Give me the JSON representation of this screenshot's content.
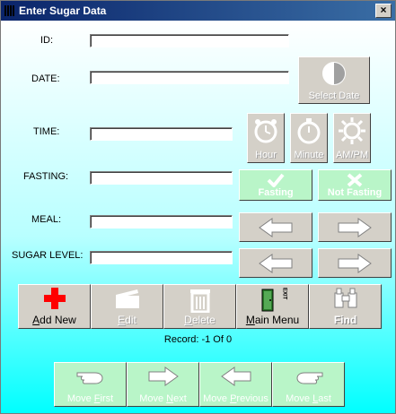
{
  "window": {
    "title": "Enter Sugar Data",
    "close_glyph": "×"
  },
  "labels": {
    "id": "ID:",
    "date": "DATE:",
    "time": "TIME:",
    "fasting": "FASTING:",
    "meal": "MEAL:",
    "sugar_level": "SUGAR LEVEL:"
  },
  "fields": {
    "id": "",
    "date": "",
    "time": "",
    "fasting": "",
    "meal": "",
    "sugar_level": ""
  },
  "buttons": {
    "select_date": "Select Date",
    "hour": "Hour",
    "minute": "Minute",
    "ampm": "AM/PM",
    "fasting": "Fasting",
    "not_fasting": "Not Fasting"
  },
  "actions": {
    "add_new_pre": "A",
    "add_new_post": "dd New",
    "edit_pre": "E",
    "edit_post": "dit",
    "delete_pre": "D",
    "delete_post": "elete",
    "main_menu_pre": "M",
    "main_menu_post": "ain Menu",
    "find": "Find",
    "exit_vertical": "EXIT"
  },
  "record": {
    "text": "Record: -1  Of  0"
  },
  "nav": {
    "move_first_pre": "Move ",
    "move_first_ul": "F",
    "move_first_post": "irst",
    "move_next_pre": "Move ",
    "move_next_ul": "N",
    "move_next_post": "ext",
    "move_previous_pre": "Move ",
    "move_previous_ul": "P",
    "move_previous_post": "revious",
    "move_last_pre": "Move ",
    "move_last_ul": "L",
    "move_last_post": "ast"
  },
  "colors": {
    "title_bar": "#0a246a",
    "button_face": "#d4d0c8",
    "green_disabled": "#b9f5c8",
    "add_red": "#ff0000",
    "bg_cyan": "#00ffff"
  }
}
